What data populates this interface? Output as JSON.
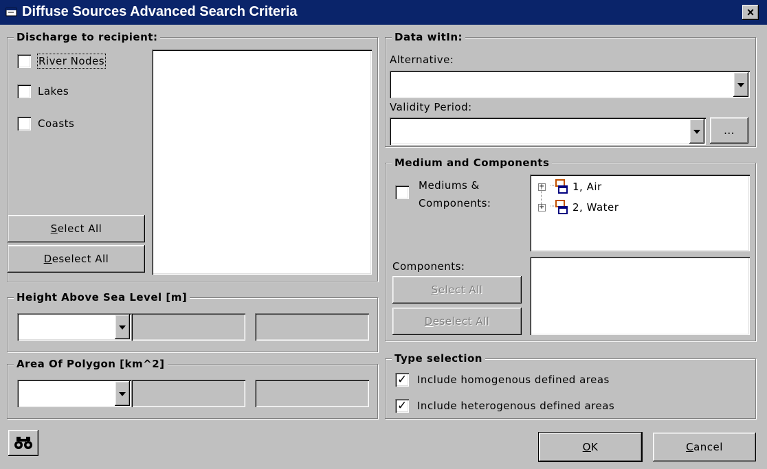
{
  "window": {
    "title": "Diffuse Sources Advanced Search Criteria",
    "close_label": "×"
  },
  "discharge": {
    "legend": "Discharge to recipient:",
    "river_nodes": {
      "label": "River Nodes",
      "checked": false
    },
    "lakes": {
      "label": "Lakes",
      "checked": false
    },
    "coasts": {
      "label": "Coasts",
      "checked": false
    },
    "select_all": {
      "key": "S",
      "rest": "elect All"
    },
    "deselect_all": {
      "key": "D",
      "rest": "eselect All"
    }
  },
  "height": {
    "legend": "Height Above Sea Level [m]",
    "operator": "",
    "value1": "",
    "value2": ""
  },
  "area": {
    "legend": "Area Of Polygon [km^2]",
    "operator": "",
    "value1": "",
    "value2": ""
  },
  "data_within": {
    "legend": "Data witIn:",
    "alternative_label": "Alternative:",
    "alternative_value": "",
    "validity_label": "Validity Period:",
    "validity_value": "",
    "browse_label": "..."
  },
  "medium": {
    "legend": "Medium and Components",
    "mediums_label_line1": "Mediums &",
    "mediums_label_line2": "Components:",
    "mediums_checked": false,
    "tree": [
      {
        "label": "1, Air",
        "expander": "+"
      },
      {
        "label": "2, Water",
        "expander": "+"
      }
    ],
    "components_label": "Components:",
    "select_all": {
      "key": "S",
      "rest": "elect All"
    },
    "deselect_all": {
      "key": "D",
      "rest": "eselect All"
    }
  },
  "type_selection": {
    "legend": "Type selection",
    "homogenous": {
      "label": "Include homogenous defined areas",
      "checked": true
    },
    "heterogenous": {
      "label": "Include heterogenous defined areas",
      "checked": true
    }
  },
  "footer": {
    "ok": {
      "key": "O",
      "rest": "K"
    },
    "cancel": {
      "key": "C",
      "rest": "ancel"
    },
    "search_icon": "binoculars-icon"
  }
}
